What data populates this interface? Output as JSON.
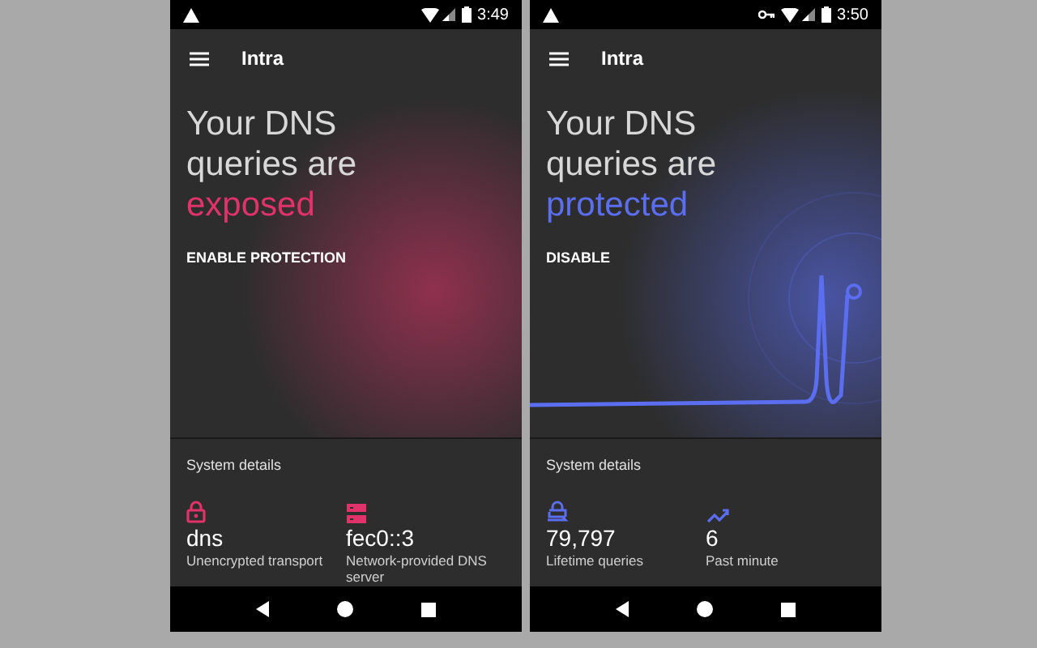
{
  "screens": [
    {
      "status_bar": {
        "time": "3:49",
        "vpn_key": false
      },
      "app_title": "Intra",
      "headline": "Your DNS queries are",
      "status_word": "exposed",
      "color": "#e0336b",
      "kind": "glow",
      "action": "ENABLE PROTECTION",
      "details_title": "System details",
      "stats": [
        {
          "kind": "lock",
          "value": "dns",
          "label": "Unencrypted transport"
        },
        {
          "kind": "server",
          "value": "fec0::3",
          "label": "Network-provided DNS server"
        }
      ]
    },
    {
      "status_bar": {
        "time": "3:50",
        "vpn_key": true
      },
      "app_title": "Intra",
      "headline": "Your DNS queries are",
      "status_word": "protected",
      "color": "#5b6ef0",
      "kind": "spike",
      "action": "DISABLE",
      "details_title": "System details",
      "stats": [
        {
          "kind": "counter",
          "value": "79,797",
          "label": "Lifetime queries"
        },
        {
          "kind": "trend",
          "value": "6",
          "label": "Past minute"
        }
      ]
    }
  ]
}
